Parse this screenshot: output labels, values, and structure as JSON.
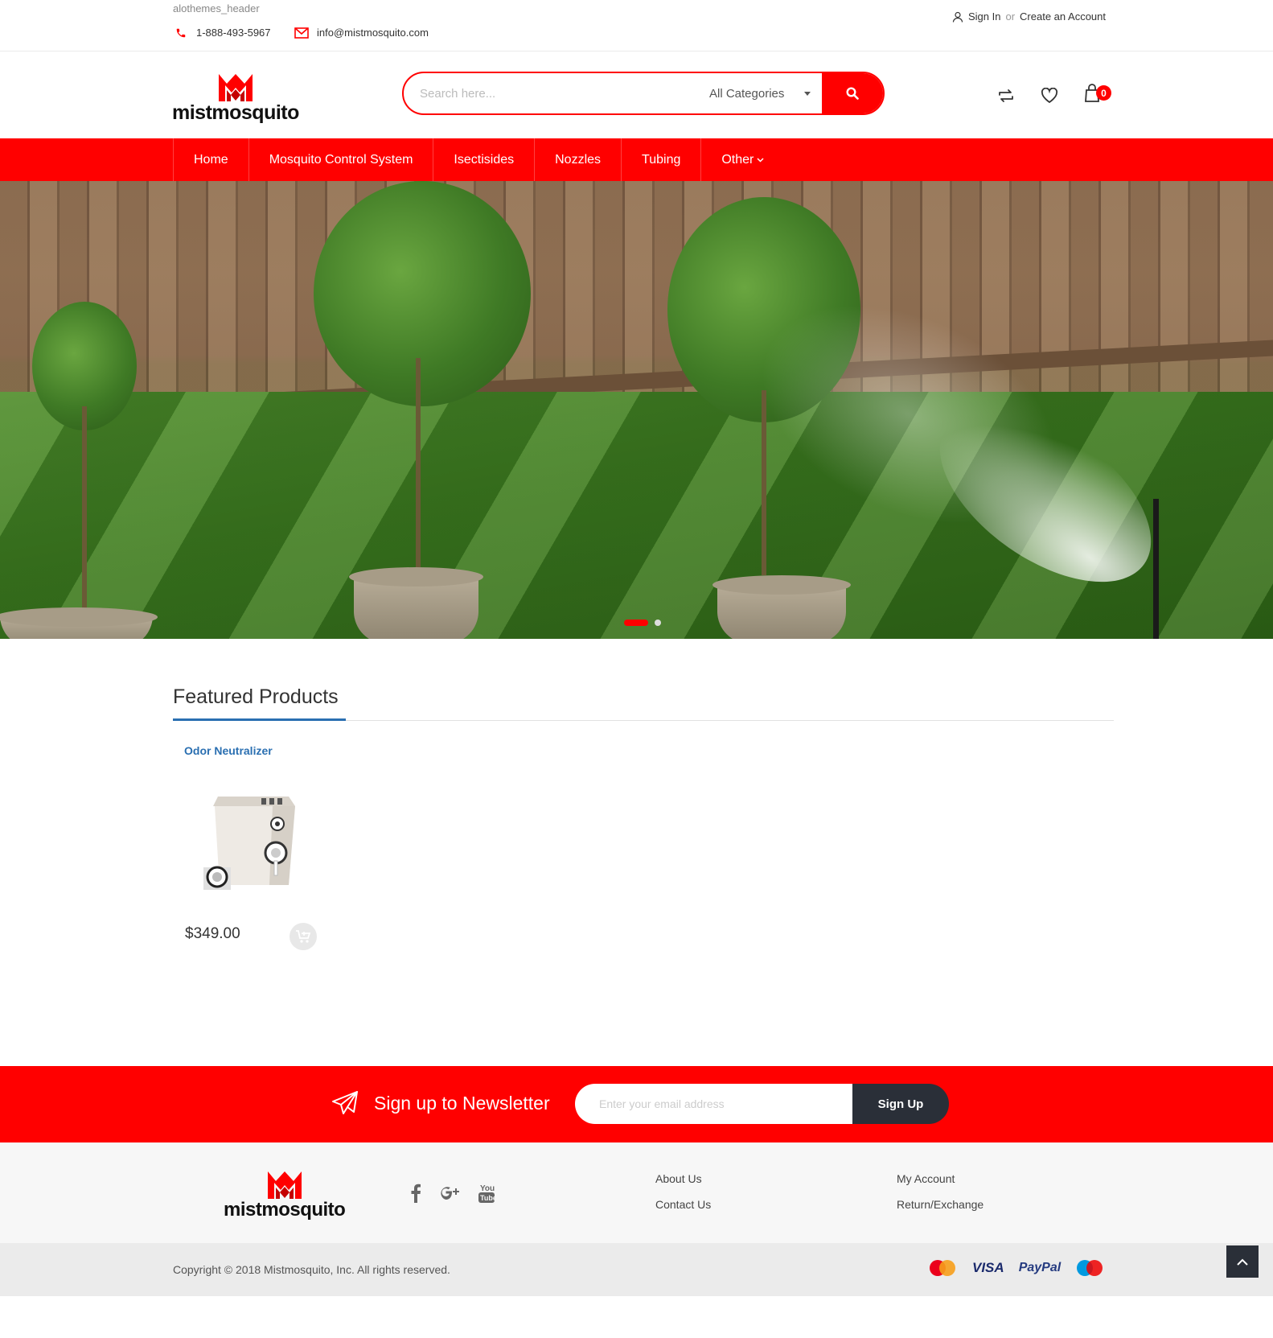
{
  "topbar": {
    "brand_text": "alothemes_header",
    "phone": "1-888-493-5967",
    "email": "info@mistmosquito.com",
    "sign_in": "Sign In",
    "or": "or",
    "create_account": "Create an Account"
  },
  "header": {
    "logo_text": "mistmosquito",
    "search_placeholder": "Search here...",
    "category_selected": "All Categories",
    "cart_count": "0"
  },
  "nav": {
    "items": [
      {
        "label": "Home"
      },
      {
        "label": "Mosquito Control System"
      },
      {
        "label": "Isectisides"
      },
      {
        "label": "Nozzles"
      },
      {
        "label": "Tubing"
      },
      {
        "label": "Other"
      }
    ]
  },
  "slider": {
    "slide_count": 2,
    "active_index": 0
  },
  "featured": {
    "title": "Featured Products",
    "products": [
      {
        "name": "Odor Neutralizer",
        "price": "$349.00"
      }
    ]
  },
  "newsletter": {
    "title": "Sign up to Newsletter",
    "placeholder": "Enter your email address",
    "button": "Sign Up"
  },
  "footer": {
    "logo_text": "mistmosquito",
    "links_col1": [
      "About Us",
      "Contact Us"
    ],
    "links_col2": [
      "My Account",
      "Return/Exchange"
    ],
    "copyright": "Copyright © 2018 Mistmosquito, Inc. All rights reserved.",
    "payments": {
      "visa": "VISA",
      "paypal": "PayPal"
    }
  },
  "colors": {
    "brand_red": "#ff0000",
    "link_blue": "#2a6fb1",
    "dark": "#2a2f38"
  }
}
